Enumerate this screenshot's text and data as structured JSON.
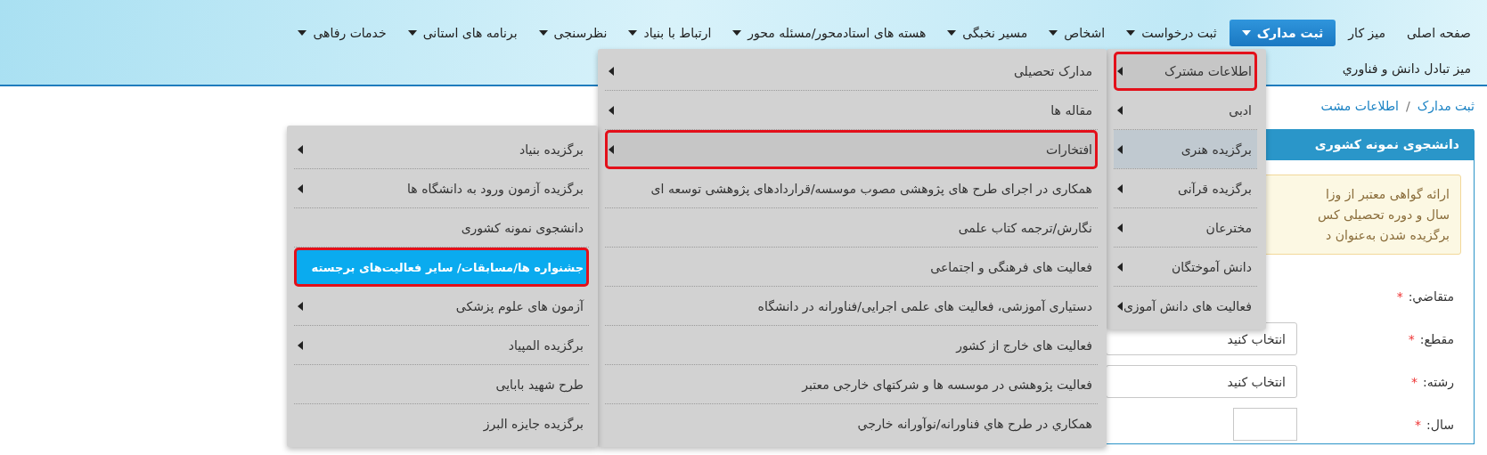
{
  "nav": {
    "rows": [
      [
        {
          "label": "صفحه اصلی",
          "active": false,
          "caret": false
        },
        {
          "label": "میز کار",
          "active": false,
          "caret": false
        },
        {
          "label": "ثبت مدارک",
          "active": true,
          "caret": true
        },
        {
          "label": "ثبت درخواست",
          "active": false,
          "caret": true
        },
        {
          "label": "اشخاص",
          "active": false,
          "caret": true
        },
        {
          "label": "مسیر نخبگی",
          "active": false,
          "caret": true
        },
        {
          "label": "هسته های استادمحور/مسئله محور",
          "active": false,
          "caret": true
        },
        {
          "label": "ارتباط با بنیاد",
          "active": false,
          "caret": true
        },
        {
          "label": "نظرسنجی",
          "active": false,
          "caret": true
        },
        {
          "label": "برنامه های استانی",
          "active": false,
          "caret": true
        },
        {
          "label": "خدمات رفاهی",
          "active": false,
          "caret": true
        }
      ],
      [
        {
          "label": "میز تبادل دانش و فناوري",
          "active": false,
          "caret": false
        }
      ]
    ]
  },
  "breadcrumb": {
    "separator": "/",
    "items": [
      {
        "label": "ثبت مدارک"
      },
      {
        "label": "اطلاعات مشت"
      }
    ]
  },
  "panel": {
    "title": "دانشجوی نمونه کشوری",
    "notice": [
      "ارائه گواهی معتبر از وزا",
      "سال و دوره تحصیلی کس",
      "برگزیده شدن به‌عنوان د"
    ],
    "fields": [
      {
        "label": "متقاضي:",
        "required_mark": "*"
      },
      {
        "label": "مقطع:",
        "required_mark": "*",
        "control": {
          "kind": "select",
          "value": "انتخاب کنید"
        }
      },
      {
        "label": "رشته:",
        "required_mark": "*",
        "control": {
          "kind": "select",
          "value": "انتخاب کنید"
        }
      },
      {
        "label": "سال:",
        "required_mark": "*",
        "control": {
          "kind": "input"
        }
      }
    ]
  },
  "menus": [
    {
      "items": [
        {
          "label": "اطلاعات مشترک",
          "submenu": true,
          "selected": true,
          "hover": false,
          "annotated": true
        },
        {
          "label": "ادبی",
          "submenu": true,
          "selected": false,
          "hover": false,
          "annotated": false
        },
        {
          "label": "برگزیده هنری",
          "submenu": true,
          "selected": false,
          "hover": true,
          "annotated": false
        },
        {
          "label": "برگزیده قرآنی",
          "submenu": true,
          "selected": false,
          "hover": false,
          "annotated": false
        },
        {
          "label": "مخترعان",
          "submenu": true,
          "selected": false,
          "hover": false,
          "annotated": false
        },
        {
          "label": "دانش آموختگان",
          "submenu": true,
          "selected": false,
          "hover": false,
          "annotated": false
        },
        {
          "label": "فعالیت های دانش آموزی",
          "submenu": true,
          "selected": false,
          "hover": false,
          "annotated": false
        }
      ]
    },
    {
      "items": [
        {
          "label": "مدارک تحصیلی",
          "submenu": true,
          "selected": false,
          "hover": false,
          "annotated": false
        },
        {
          "label": "مقاله ها",
          "submenu": true,
          "selected": false,
          "hover": false,
          "annotated": false
        },
        {
          "label": "افتخارات",
          "submenu": true,
          "selected": true,
          "hover": false,
          "annotated": true
        },
        {
          "label": "همکاری در اجرای طرح های پژوهشی مصوب موسسه/قراردادهای پژوهشی توسعه ای",
          "submenu": false,
          "selected": false,
          "hover": false,
          "annotated": false
        },
        {
          "label": "نگارش/ترجمه کتاب علمی",
          "submenu": false,
          "selected": false,
          "hover": false,
          "annotated": false
        },
        {
          "label": "فعالیت های فرهنگی و اجتماعی",
          "submenu": false,
          "selected": false,
          "hover": false,
          "annotated": false
        },
        {
          "label": "دستیاری آموزشی، فعالیت های علمی اجرایی/فناورانه در دانشگاه",
          "submenu": false,
          "selected": false,
          "hover": false,
          "annotated": false
        },
        {
          "label": "فعالیت های خارج از کشور",
          "submenu": false,
          "selected": false,
          "hover": false,
          "annotated": false
        },
        {
          "label": "فعالیت پژوهشی در موسسه ها و شرکتهای خارجی معتبر",
          "submenu": false,
          "selected": false,
          "hover": false,
          "annotated": false
        },
        {
          "label": "همکاري در طرح هاي فناورانه/نوآورانه خارجي",
          "submenu": false,
          "selected": false,
          "hover": false,
          "annotated": false
        }
      ]
    },
    {
      "items": [
        {
          "label": "برگزیده بنیاد",
          "submenu": true,
          "selected": false,
          "hover": false,
          "annotated": false
        },
        {
          "label": "برگزیده آزمون ورود به دانشگاه ها",
          "submenu": true,
          "selected": false,
          "hover": false,
          "annotated": false
        },
        {
          "label": "دانشجوی نمونه کشوری",
          "submenu": false,
          "selected": false,
          "hover": false,
          "annotated": false
        },
        {
          "label": "جشنواره ها/مسابقات/ سایر فعالیت‌های برجسته",
          "submenu": false,
          "selected": true,
          "hover": false,
          "annotated": true
        },
        {
          "label": "آزمون های علوم پزشکی",
          "submenu": true,
          "selected": false,
          "hover": false,
          "annotated": false
        },
        {
          "label": "برگزیده المپیاد",
          "submenu": true,
          "selected": false,
          "hover": false,
          "annotated": false
        },
        {
          "label": "طرح شهید بابایی",
          "submenu": false,
          "selected": false,
          "hover": false,
          "annotated": false
        },
        {
          "label": "برگزیده جایزه البرز",
          "submenu": false,
          "selected": false,
          "hover": false,
          "annotated": false
        }
      ]
    }
  ]
}
